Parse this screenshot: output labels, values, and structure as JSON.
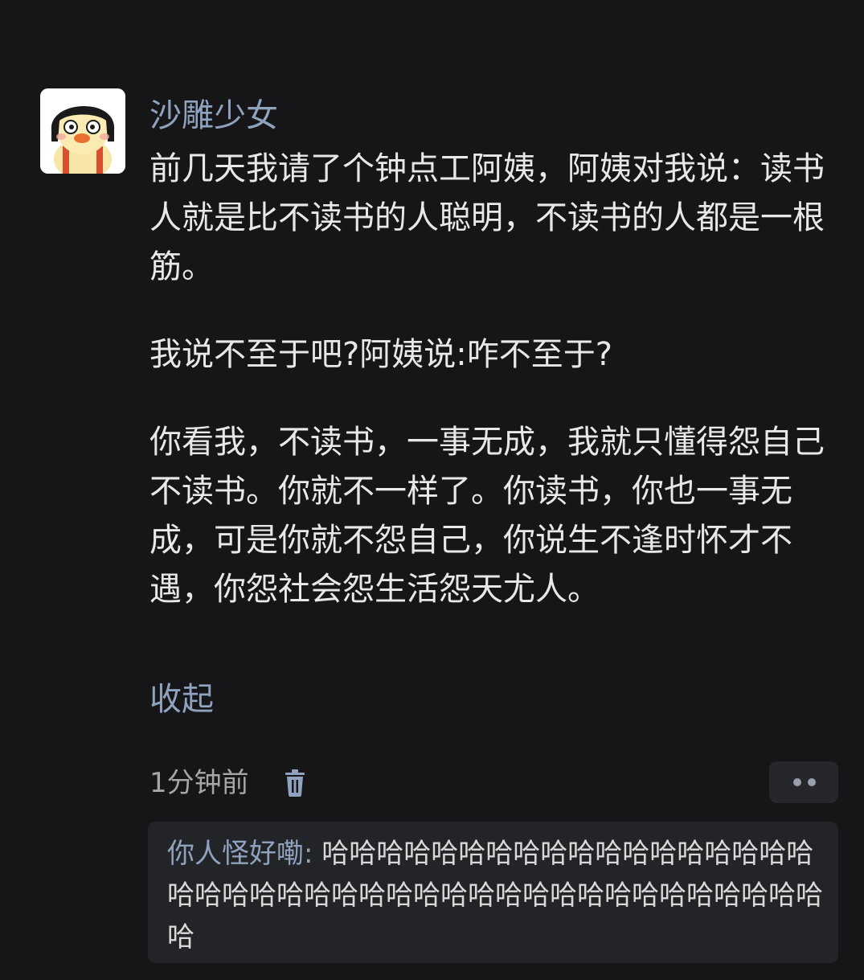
{
  "post": {
    "username": "沙雕少女",
    "avatar_icon": "cartoon-girl-avatar",
    "paragraphs": [
      "前几天我请了个钟点工阿姨，阿姨对我说：读书人就是比不读书的人聪明，不读书的人都是一根筋。",
      "我说不至于吧?阿姨说:咋不至于?",
      "你看我，不读书，一事无成，我就只懂得怨自己不读书。你就不一样了。你读书，你也一事无成，可是你就不怨自己，你说生不逢时怀才不遇，你怨社会怨生活怨天尤人。"
    ],
    "collapse_label": "收起"
  },
  "meta": {
    "time": "1分钟前",
    "delete_icon": "trash-icon",
    "more_icon": "more-dots-icon"
  },
  "reply": {
    "author": "你人怪好嘞:",
    "text": "哈哈哈哈哈哈哈哈哈哈哈哈哈哈哈哈哈哈哈哈哈哈哈哈哈哈哈哈哈哈哈哈哈哈哈哈哈哈哈哈哈哈哈"
  },
  "colors": {
    "background": "#161618",
    "link_blue": "#8fa3be",
    "text": "#e8e8e8",
    "muted": "#a6a6a6",
    "reply_bg": "#232427"
  }
}
